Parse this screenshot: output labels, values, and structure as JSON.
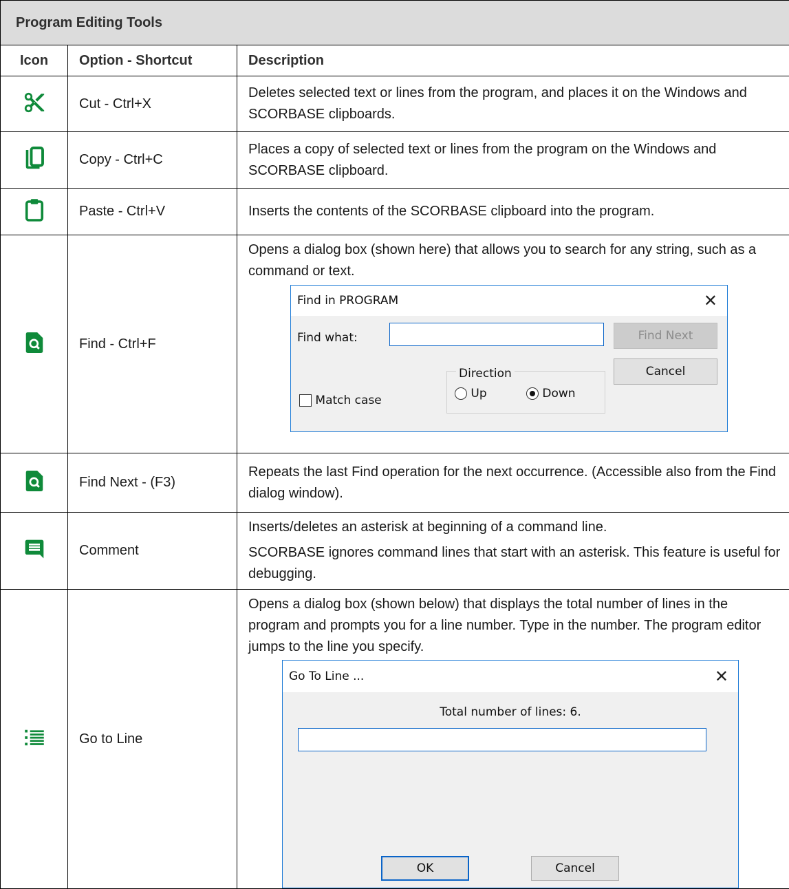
{
  "table": {
    "title": "Program Editing Tools",
    "headers": {
      "icon": "Icon",
      "option": "Option - Shortcut",
      "description": "Description"
    },
    "rows": [
      {
        "icon": "scissors-icon",
        "option": "Cut - Ctrl+X",
        "description": "Deletes selected text or lines from the program, and places it on the Windows and SCORBASE clipboards."
      },
      {
        "icon": "copy-icon",
        "option": "Copy - Ctrl+C",
        "description": "Places a copy of selected text or lines from the program on the Windows and SCORBASE clipboard."
      },
      {
        "icon": "clipboard-icon",
        "option": "Paste - Ctrl+V",
        "description": "Inserts the contents of the SCORBASE clipboard into the program."
      },
      {
        "icon": "find-icon",
        "option": "Find - Ctrl+F",
        "description": "Opens a dialog box (shown here) that allows you to search for any string, such as a command or text."
      },
      {
        "icon": "find-next-icon",
        "option": "Find Next - (F3)",
        "description": "Repeats the last Find operation for the next occurrence. (Accessible also from the Find dialog window)."
      },
      {
        "icon": "comment-icon",
        "option": "Comment",
        "description": "Inserts/deletes an asterisk at beginning of a command line.",
        "description2": "SCORBASE ignores command lines that start with an asterisk. This feature is useful for debugging."
      },
      {
        "icon": "list-icon",
        "option": "Go to Line",
        "description": "Opens a dialog box (shown below) that displays the total number of lines in the program and prompts you for a line number. Type in the number. The program editor jumps to the line you specify."
      }
    ]
  },
  "find_dialog": {
    "title": "Find in  PROGRAM",
    "find_what_label": "Find what:",
    "find_what_value": "",
    "find_next_label": "Find Next",
    "cancel_label": "Cancel",
    "direction_label": "Direction",
    "up_label": "Up",
    "down_label": "Down",
    "direction_selected": "Down",
    "match_case_label": "Match case",
    "match_case_checked": false
  },
  "goto_dialog": {
    "title": "Go To Line ...",
    "total_lines_text": "Total number of lines: 6.",
    "line_value": "",
    "ok_label": "OK",
    "cancel_label": "Cancel"
  },
  "colors": {
    "icon_green": "#0f8a3a",
    "header_bg": "#dcdcdc",
    "dialog_border": "#1e7bd6"
  }
}
